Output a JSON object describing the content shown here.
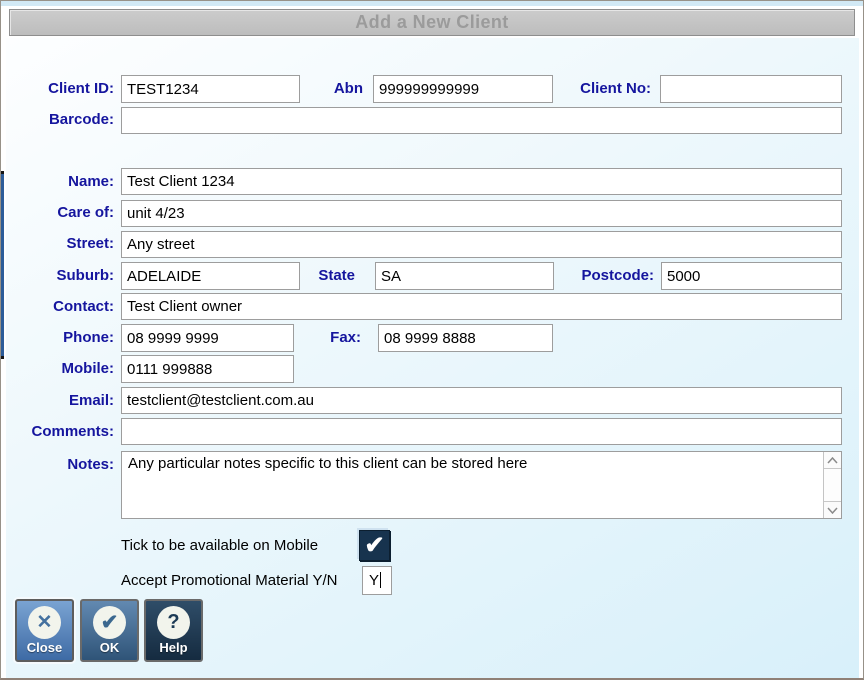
{
  "dialog": {
    "title": "Add a New Client"
  },
  "fields": {
    "client_id": {
      "label": "Client ID:",
      "value": "TEST1234"
    },
    "abn": {
      "label": "Abn",
      "value": "999999999999"
    },
    "client_no": {
      "label": "Client No:",
      "value": ""
    },
    "barcode": {
      "label": "Barcode:",
      "value": ""
    },
    "name": {
      "label": "Name:",
      "value": "Test Client 1234"
    },
    "care_of": {
      "label": "Care of:",
      "value": "unit 4/23"
    },
    "street": {
      "label": "Street:",
      "value": "Any street"
    },
    "suburb": {
      "label": "Suburb:",
      "value": "ADELAIDE"
    },
    "state": {
      "label": "State",
      "value": "SA"
    },
    "postcode": {
      "label": "Postcode:",
      "value": "5000"
    },
    "contact": {
      "label": "Contact:",
      "value": "Test Client owner"
    },
    "phone": {
      "label": "Phone:",
      "value": "08 9999 9999"
    },
    "fax": {
      "label": "Fax:",
      "value": "08 9999 8888"
    },
    "mobile": {
      "label": "Mobile:",
      "value": "0111 999888"
    },
    "email": {
      "label": "Email:",
      "value": "testclient@testclient.com.au"
    },
    "comments": {
      "label": "Comments:",
      "value": ""
    },
    "notes": {
      "label": "Notes:",
      "value": "Any particular notes specific to this client can be stored here"
    }
  },
  "options": {
    "mobile_checkbox_label": "Tick to be available on Mobile",
    "mobile_checkbox_checked": true,
    "checkbox_glyph": "✔",
    "promo_label": "Accept Promotional Material Y/N",
    "promo_value": "Y"
  },
  "buttons": {
    "close": {
      "label": "Close",
      "glyph": "✕"
    },
    "ok": {
      "label": "OK",
      "glyph": "✔"
    },
    "help": {
      "label": "Help",
      "glyph": "?"
    }
  },
  "colors": {
    "label_navy": "#15159e",
    "titlebar_gray": "#c4c4c4",
    "title_text_gray": "#9b9b9b",
    "checkbox_navy": "#17334e",
    "close_button_blue": "#3e6ba5",
    "ok_button_blue": "#2f5478",
    "help_button_navy": "#152b40",
    "background_blue": "#d8f0fa"
  }
}
